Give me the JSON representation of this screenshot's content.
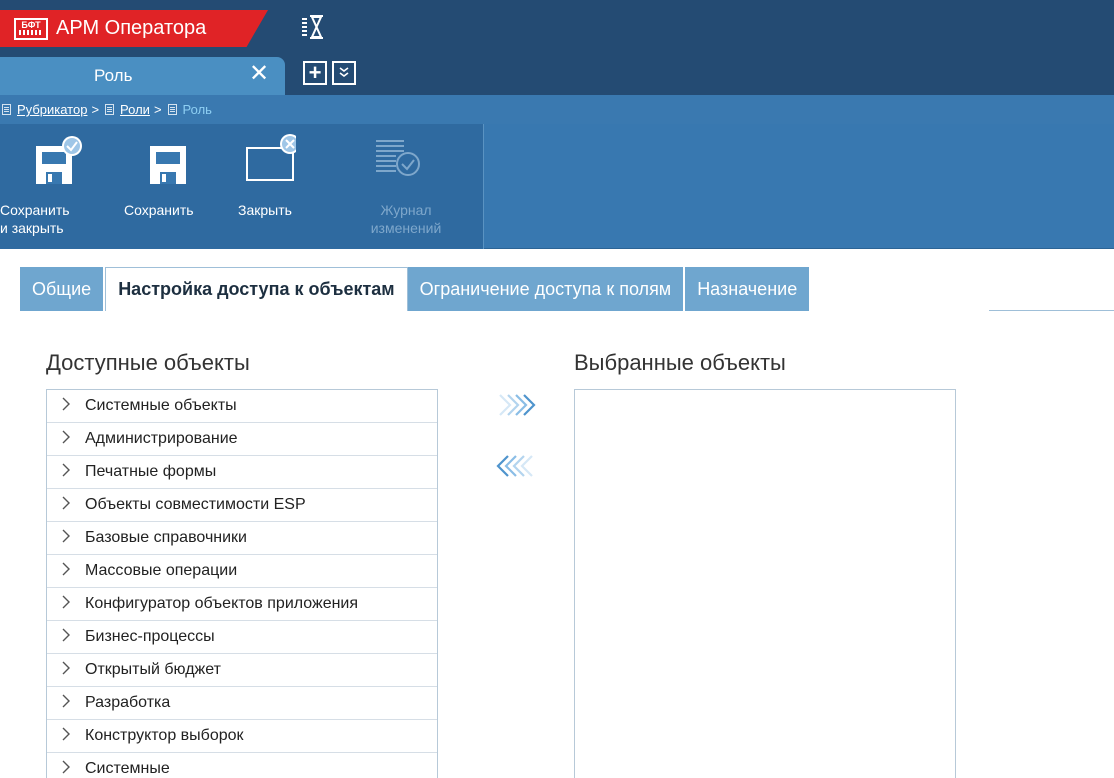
{
  "app": {
    "title": "АРМ Оператора",
    "logo_text": "БФТ"
  },
  "doc_tab": {
    "label": "Роль",
    "close": "✕",
    "add": "+",
    "more": "»"
  },
  "breadcrumb": {
    "items": [
      "Рубрикатор",
      "Роли",
      "Роль"
    ],
    "separator": ">"
  },
  "toolbar": {
    "save_close": "Сохранить\nи закрыть",
    "save": "Сохранить",
    "close": "Закрыть",
    "journal": "Журнал\nизменений"
  },
  "tabs": [
    "Общие",
    "Настройка доступа к объектам",
    "Ограничение доступа к полям",
    "Назначение"
  ],
  "available": {
    "title": "Доступные объекты",
    "items": [
      "Системные объекты",
      "Администрирование",
      "Печатные формы",
      "Объекты совместимости ESP",
      "Базовые справочники",
      "Массовые операции",
      "Конфигуратор объектов приложения",
      "Бизнес-процессы",
      "Открытый бюджет",
      "Разработка",
      "Конструктор выборок",
      "Системные"
    ]
  },
  "selected": {
    "title": "Выбранные объекты"
  },
  "colors": {
    "topbar": "#244b73",
    "brand_red": "#e02326",
    "tab_active": "#4a8fc2",
    "toolbar": "#3878b0",
    "content_tab": "#6fa6cf",
    "arrow_accent": "#5b9fd2"
  },
  "icons": {
    "chevron": "›",
    "tree_chevron": "›"
  }
}
